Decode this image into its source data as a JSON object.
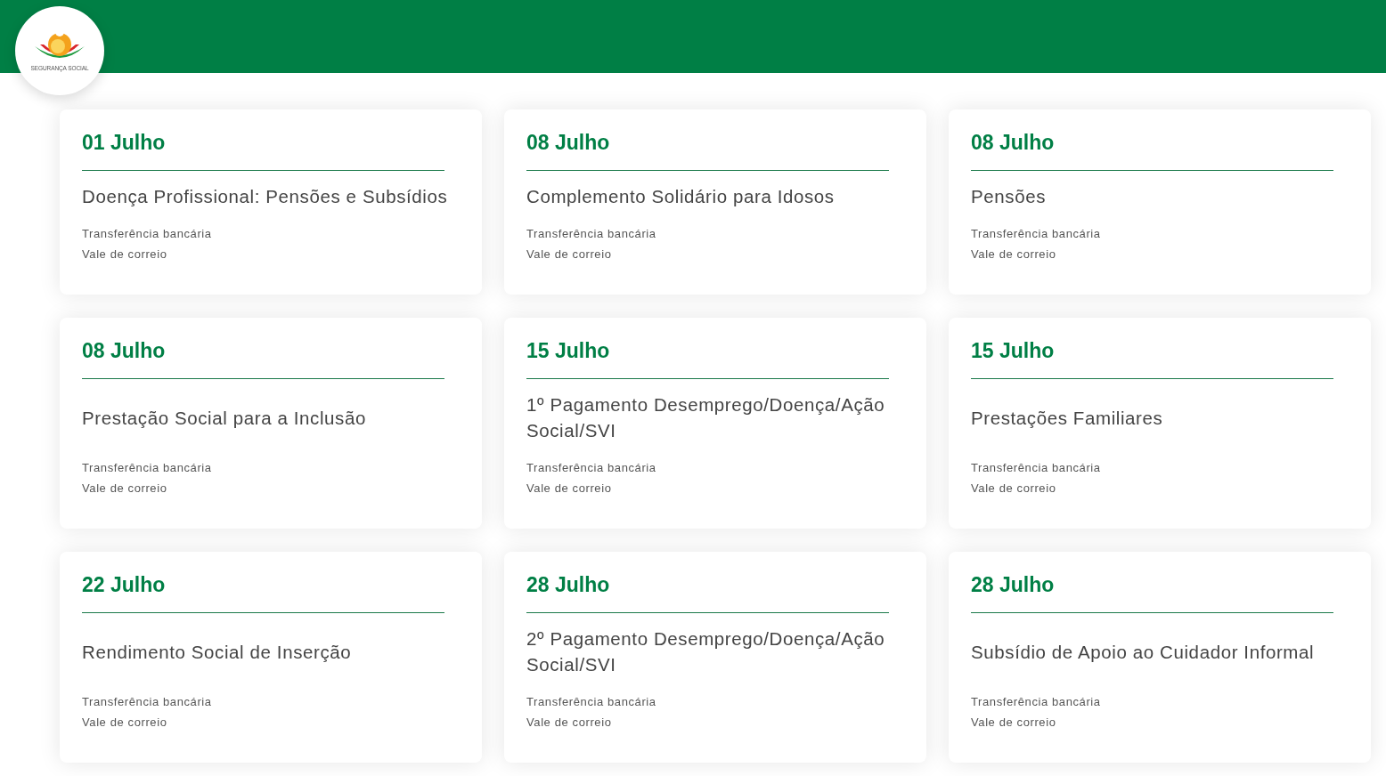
{
  "header": {
    "logo_text": "SEGURANÇA SOCIAL"
  },
  "cards": [
    {
      "date": "01 Julho",
      "title": "Doença Profissional: Pensões e Subsídios",
      "methods": [
        "Transferência bancária",
        "Vale de correio"
      ]
    },
    {
      "date": "08 Julho",
      "title": "Complemento Solidário para Idosos",
      "methods": [
        "Transferência bancária",
        "Vale de correio"
      ]
    },
    {
      "date": "08 Julho",
      "title": "Pensões",
      "methods": [
        "Transferência bancária",
        "Vale de correio"
      ]
    },
    {
      "date": "08 Julho",
      "title": "Prestação Social para a Inclusão",
      "methods": [
        "Transferência bancária",
        "Vale de correio"
      ]
    },
    {
      "date": "15 Julho",
      "title": "1º Pagamento Desemprego/Doença/Ação Social/SVI",
      "methods": [
        "Transferência bancária",
        "Vale de correio"
      ]
    },
    {
      "date": "15 Julho",
      "title": "Prestações Familiares",
      "methods": [
        "Transferência bancária",
        "Vale de correio"
      ]
    },
    {
      "date": "22 Julho",
      "title": "Rendimento Social de Inserção",
      "methods": [
        "Transferência bancária",
        "Vale de correio"
      ]
    },
    {
      "date": "28 Julho",
      "title": "2º Pagamento Desemprego/Doença/Ação Social/SVI",
      "methods": [
        "Transferência bancária",
        "Vale de correio"
      ]
    },
    {
      "date": "28 Julho",
      "title": "Subsídio de Apoio ao Cuidador Informal",
      "methods": [
        "Transferência bancária",
        "Vale de correio"
      ]
    }
  ]
}
